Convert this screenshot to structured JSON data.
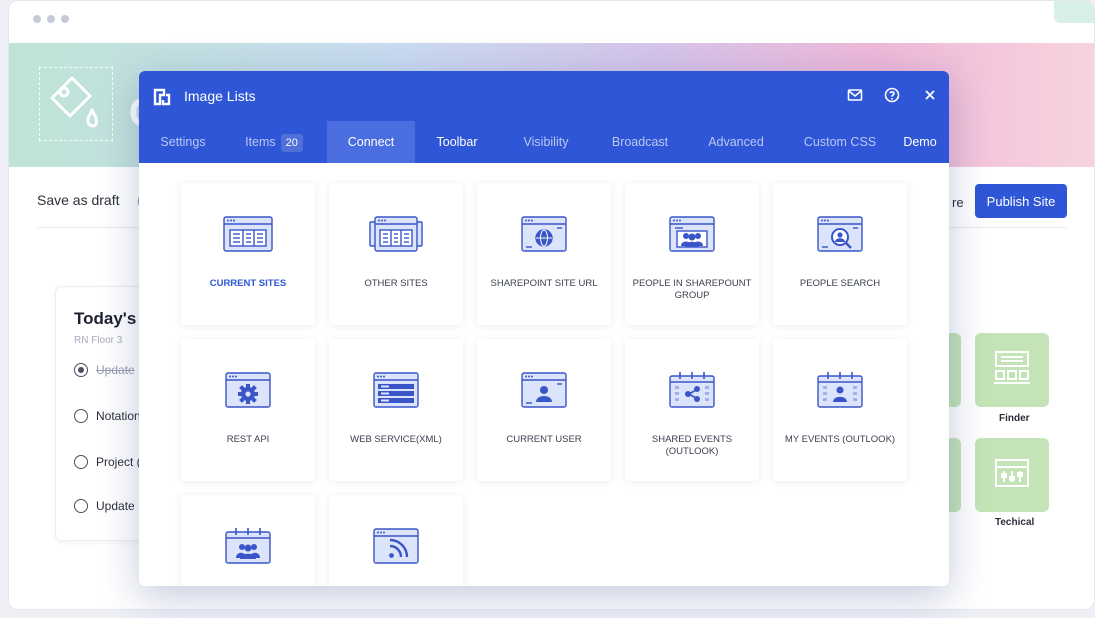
{
  "page": {
    "hero_letter": "C",
    "save_draft": "Save as draft",
    "save_sep": "(",
    "partial_right": "re",
    "publish": "Publish Site"
  },
  "today": {
    "title": "Today's",
    "subtitle": "RN Floor 3",
    "items": [
      {
        "label": "Update",
        "done": true
      },
      {
        "label": "Notation",
        "done": false
      },
      {
        "label": "Project (",
        "done": false
      },
      {
        "label": "Update",
        "done": false
      }
    ]
  },
  "tiles": {
    "finder": "Finder",
    "technical": "Techical"
  },
  "modal": {
    "title": "Image Lists",
    "header_icons": [
      "mail-icon",
      "help-icon",
      "close-icon"
    ],
    "tabs": [
      {
        "label": "Settings"
      },
      {
        "label": "Items",
        "badge": "20"
      },
      {
        "label": "Connect",
        "active": true
      },
      {
        "label": "Toolbar"
      },
      {
        "label": "Visibility"
      },
      {
        "label": "Broadcast"
      },
      {
        "label": "Advanced"
      },
      {
        "label": "Custom CSS"
      },
      {
        "label": "Demo"
      }
    ],
    "cards": [
      {
        "label": "CURRENT SITES",
        "icon": "browser-list-icon",
        "selected": true
      },
      {
        "label": "OTHER SITES",
        "icon": "stacked-browser-icon"
      },
      {
        "label": "SHAREPOINT SITE URL",
        "icon": "globe-icon"
      },
      {
        "label": "PEOPLE IN SHAREPOUNT GROUP",
        "icon": "people-group-icon"
      },
      {
        "label": "PEOPLE SEARCH",
        "icon": "person-search-icon"
      },
      {
        "label": "REST API",
        "icon": "gear-icon"
      },
      {
        "label": "WEB SERVICE(XML)",
        "icon": "web-service-icon"
      },
      {
        "label": "CURRENT USER",
        "icon": "user-icon"
      },
      {
        "label": "SHARED EVENTS (OUTLOOK)",
        "icon": "shared-calendar-icon"
      },
      {
        "label": "MY EVENTS (OUTLOOK)",
        "icon": "user-calendar-icon"
      },
      {
        "label": "",
        "icon": "group-calendar-icon"
      },
      {
        "label": "",
        "icon": "rss-icon"
      }
    ]
  },
  "colors": {
    "primary": "#2f56d6",
    "tab_active": "#4a6ee0",
    "icon_stroke": "#3a55c8",
    "icon_fill": "#dbe4fb",
    "tile_green": "#c4e4b8"
  }
}
